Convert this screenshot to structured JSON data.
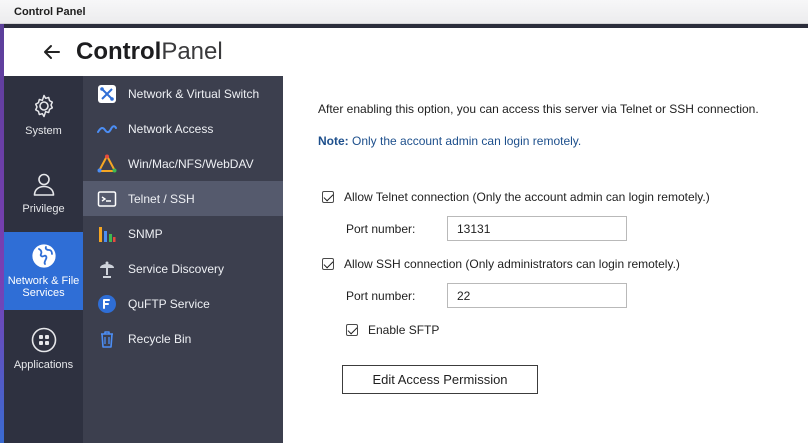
{
  "window": {
    "title": "Control Panel"
  },
  "header": {
    "title_bold": "Control",
    "title_light": "Panel"
  },
  "rail": [
    {
      "label": "System",
      "icon": "gear-icon"
    },
    {
      "label": "Privilege",
      "icon": "user-icon"
    },
    {
      "label": "Network & File Services",
      "icon": "globe-icon",
      "active": true
    },
    {
      "label": "Applications",
      "icon": "apps-grid-icon"
    }
  ],
  "menu": [
    {
      "label": "Network & Virtual Switch",
      "icon": "network-switch-icon"
    },
    {
      "label": "Network Access",
      "icon": "network-access-icon"
    },
    {
      "label": "Win/Mac/NFS/WebDAV",
      "icon": "file-protocols-icon"
    },
    {
      "label": "Telnet / SSH",
      "icon": "terminal-icon",
      "active": true
    },
    {
      "label": "SNMP",
      "icon": "snmp-bars-icon"
    },
    {
      "label": "Service Discovery",
      "icon": "satellite-dish-icon"
    },
    {
      "label": "QuFTP Service",
      "icon": "ftp-icon"
    },
    {
      "label": "Recycle Bin",
      "icon": "trash-icon"
    }
  ],
  "content": {
    "description": "After enabling this option, you can access this server via Telnet or SSH connection.",
    "note_prefix": "Note:",
    "note_text": " Only the account admin can login remotely.",
    "telnet": {
      "label": "Allow Telnet connection (Only the account admin can login remotely.)",
      "checked": true,
      "port_label": "Port number:",
      "port_value": "13131"
    },
    "ssh": {
      "label": "Allow SSH connection (Only administrators can login remotely.)",
      "checked": true,
      "port_label": "Port number:",
      "port_value": "22"
    },
    "sftp": {
      "label": "Enable SFTP",
      "checked": true
    },
    "button_label": "Edit Access Permission"
  },
  "colors": {
    "rail_bg": "#2e3140",
    "menu_bg": "#3c3f4e",
    "active_blue": "#2f6ed6",
    "note_blue": "#1d4f8c"
  }
}
